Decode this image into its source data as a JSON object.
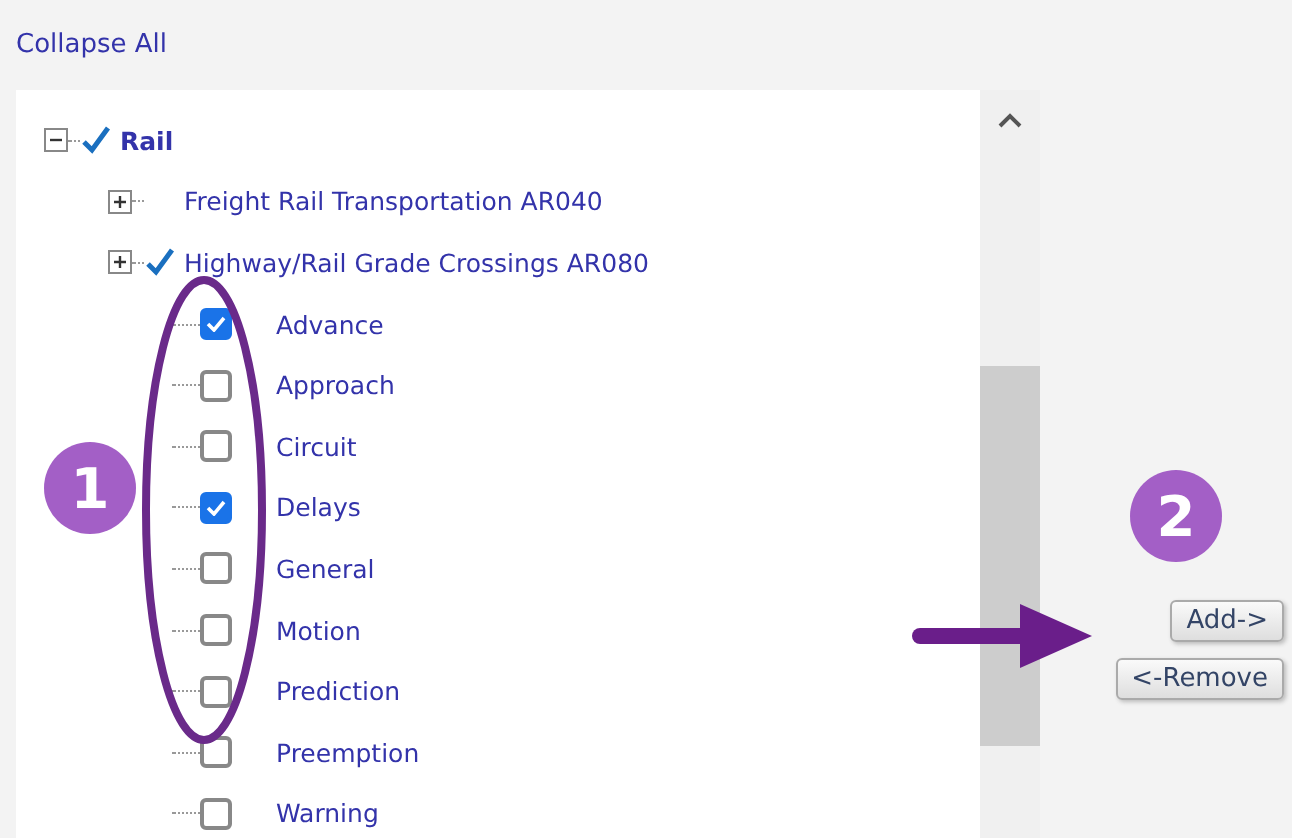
{
  "collapse_all": "Collapse All",
  "tree": [
    {
      "label": "Rail",
      "kind": "branch",
      "expanded": true,
      "checked": true,
      "children": [
        {
          "label": "Freight Rail Transportation AR040",
          "kind": "branch",
          "expanded": false,
          "checked": false
        },
        {
          "label": "Highway/Rail Grade Crossings AR080",
          "kind": "branch",
          "expanded": false,
          "checked": true,
          "children": [
            {
              "label": "Advance",
              "kind": "checkbox",
              "checked": true
            },
            {
              "label": "Approach",
              "kind": "checkbox",
              "checked": false
            },
            {
              "label": "Circuit",
              "kind": "checkbox",
              "checked": false
            },
            {
              "label": "Delays",
              "kind": "checkbox",
              "checked": true
            },
            {
              "label": "General",
              "kind": "checkbox",
              "checked": false
            },
            {
              "label": "Motion",
              "kind": "checkbox",
              "checked": false
            },
            {
              "label": "Prediction",
              "kind": "checkbox",
              "checked": false
            },
            {
              "label": "Preemption",
              "kind": "checkbox",
              "checked": false
            },
            {
              "label": "Warning",
              "kind": "checkbox",
              "checked": false
            }
          ]
        }
      ]
    }
  ],
  "buttons": [
    {
      "label": "Add->"
    },
    {
      "label": "<-Remove"
    }
  ],
  "annotations": [
    {
      "label": "1"
    },
    {
      "label": "2"
    }
  ]
}
